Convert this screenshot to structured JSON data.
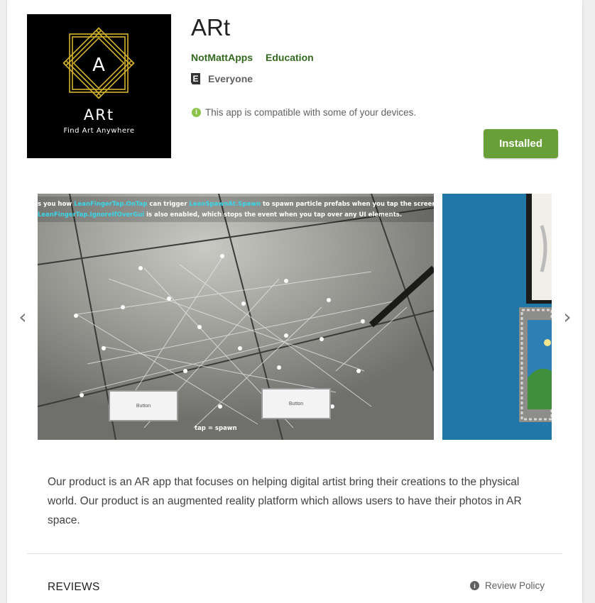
{
  "app": {
    "title": "ARt",
    "developer": "NotMattApps",
    "category": "Education",
    "content_rating": "Everyone",
    "compatibility": "This app is compatible with some of your devices.",
    "install_button": "Installed",
    "icon": {
      "letter": "A",
      "name": "ARt",
      "tagline": "Find Art Anywhere"
    }
  },
  "screenshot_1": {
    "caption_line1_parts": [
      "s you how ",
      "LeanFingerTap.OnTap",
      " can trigger ",
      "LeanSpawnAt.Spawn",
      " to spawn particle prefabs when you tap the screen."
    ],
    "caption_line2_parts": [
      "LeanFingerTap.IgnoreIfOverGui",
      " is also enabled, which stops the event when you tap over any UI elements."
    ],
    "button_left": "Button",
    "button_right": "Button",
    "bottom_hint": "tap = spawn"
  },
  "description": "Our product is an AR app that focuses on helping digital artist bring their creations to the physical world. Our product is an augmented reality platform which allows users to have their photos in AR space.",
  "reviews": {
    "heading": "REVIEWS",
    "policy_label": "Review Policy"
  },
  "colors": {
    "accent_green": "#689f38",
    "link_green": "#33691e",
    "icon_gold": "#d4b32a",
    "caption_cyan": "#3ad6e8",
    "wall_blue": "#1f78a8"
  },
  "icons": {
    "prev": "chevron-left-icon",
    "next": "chevron-right-icon",
    "rating": "everyone-rating-icon",
    "compat": "info-icon",
    "policy": "info-icon"
  }
}
